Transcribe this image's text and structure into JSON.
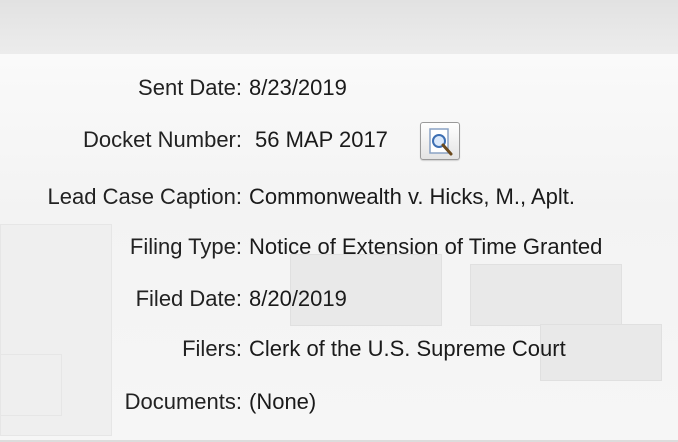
{
  "fields": {
    "sent_date": {
      "label": "Sent Date:",
      "value": "8/23/2019"
    },
    "docket_number": {
      "label": "Docket Number:",
      "value": "56 MAP 2017"
    },
    "lead_case_caption": {
      "label": "Lead Case Caption:",
      "value": "Commonwealth v. Hicks, M., Aplt."
    },
    "filing_type": {
      "label": "Filing Type:",
      "value": "Notice of Extension of Time Granted"
    },
    "filed_date": {
      "label": "Filed Date:",
      "value": "8/20/2019"
    },
    "filers": {
      "label": "Filers:",
      "value": "Clerk of the U.S. Supreme Court"
    },
    "documents": {
      "label": "Documents:",
      "value": "(None)"
    }
  },
  "icons": {
    "docket_lookup": "magnifier-document-icon"
  }
}
